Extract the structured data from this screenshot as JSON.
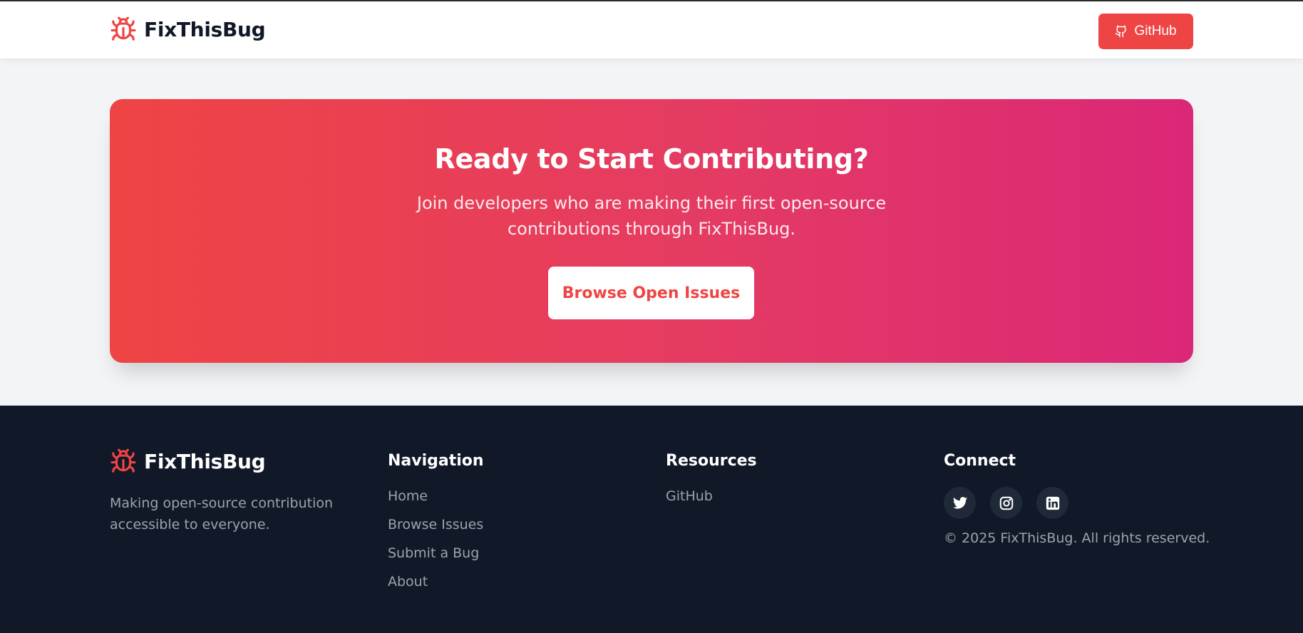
{
  "brand": {
    "name": "FixThisBug",
    "icon": "bug-icon",
    "color": "#ef4444"
  },
  "header": {
    "github_label": "GitHub",
    "github_icon": "github-icon"
  },
  "cta": {
    "title": "Ready to Start Contributing?",
    "subtitle": "Join developers who are making their first open-source contributions through FixThisBug.",
    "button_label": "Browse Open Issues",
    "gradient_start": "#ef4444",
    "gradient_end": "#db2777"
  },
  "footer": {
    "tagline": "Making open-source contribution accessible to everyone.",
    "navigation": {
      "title": "Navigation",
      "links": [
        "Home",
        "Browse Issues",
        "Submit a Bug",
        "About"
      ]
    },
    "resources": {
      "title": "Resources",
      "links": [
        "GitHub"
      ]
    },
    "connect": {
      "title": "Connect",
      "socials": [
        "twitter-icon",
        "instagram-icon",
        "linkedin-icon"
      ],
      "copyright": "© 2025 FixThisBug. All rights reserved."
    },
    "background": "#111827"
  }
}
